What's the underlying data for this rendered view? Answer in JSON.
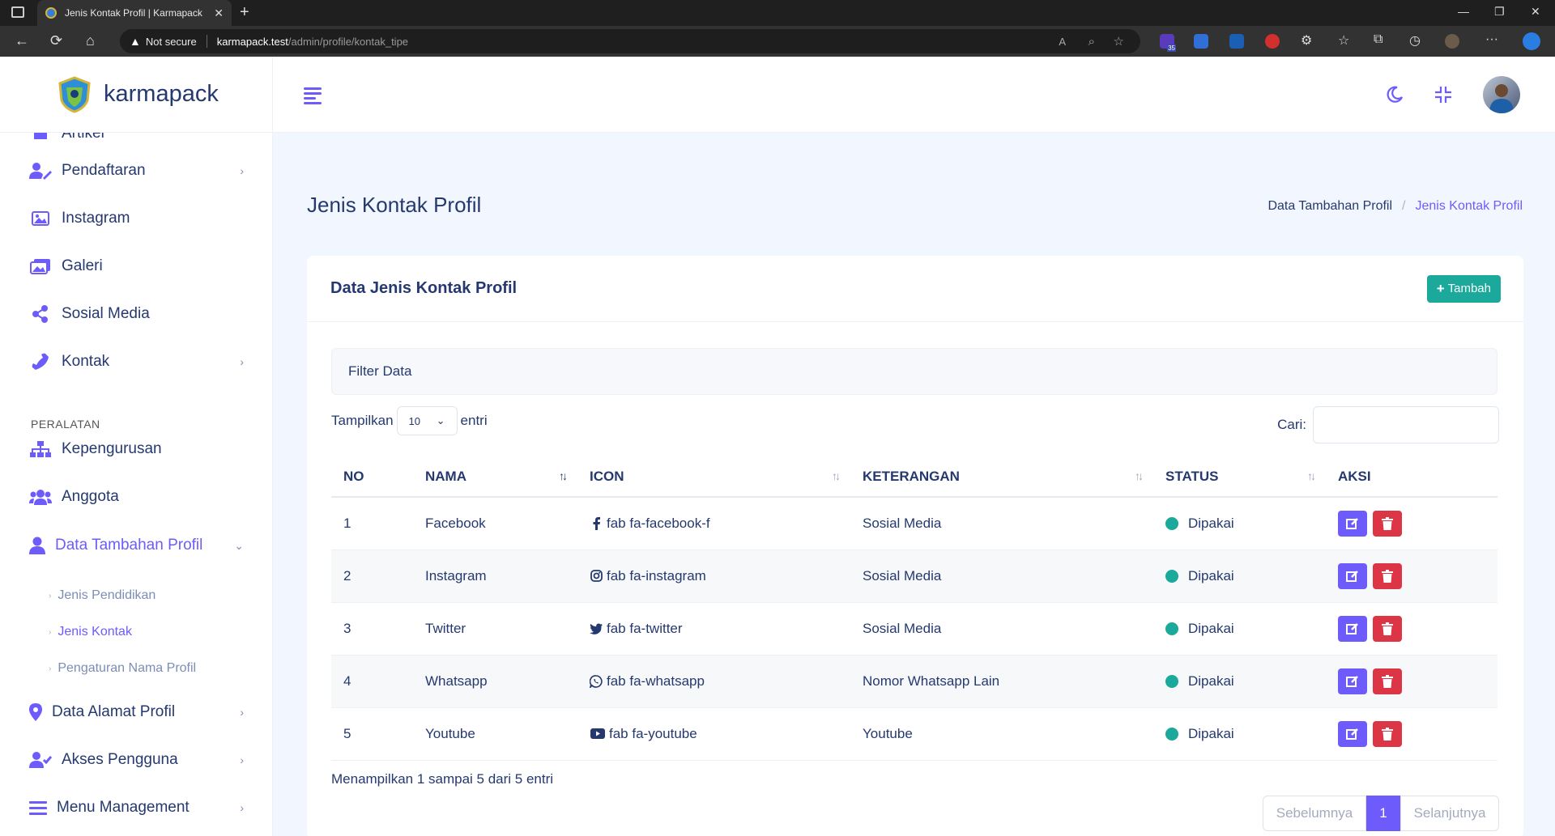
{
  "browser": {
    "tab_title": "Jenis Kontak Profil | Karmapack",
    "security_label": "Not secure",
    "url_host": "karmapack.test",
    "url_path": "/admin/profile/kontak_tipe",
    "tab_close": "✕",
    "new_tab": "+",
    "ext_badge": "35"
  },
  "sidebar": {
    "brand": "karmapack",
    "partial_item": "Artikel",
    "items": [
      {
        "label": "Pendaftaran",
        "icon": "user-edit-icon",
        "has_caret": true
      },
      {
        "label": "Instagram",
        "icon": "image-icon",
        "has_caret": false
      },
      {
        "label": "Galeri",
        "icon": "images-icon",
        "has_caret": false
      },
      {
        "label": "Sosial Media",
        "icon": "share-icon",
        "has_caret": false
      },
      {
        "label": "Kontak",
        "icon": "phone-icon",
        "has_caret": true
      }
    ],
    "section_title": "PERALATAN",
    "tools": [
      {
        "label": "Kepengurusan",
        "icon": "sitemap-icon"
      },
      {
        "label": "Anggota",
        "icon": "users-icon"
      },
      {
        "label": "Data Tambahan Profil",
        "icon": "user-icon"
      }
    ],
    "sub_items": [
      "Jenis Pendidikan",
      "Jenis Kontak",
      "Pengaturan Nama Profil"
    ],
    "bottom_items": [
      {
        "label": "Data Alamat Profil",
        "icon": "map-marker-icon"
      },
      {
        "label": "Akses Pengguna",
        "icon": "user-check-icon"
      },
      {
        "label": "Menu Management",
        "icon": "bars-icon"
      }
    ]
  },
  "page": {
    "title": "Jenis Kontak Profil",
    "breadcrumb": {
      "parent": "Data Tambahan Profil",
      "separator": "/",
      "current": "Jenis Kontak Profil"
    }
  },
  "card": {
    "title": "Data Jenis Kontak Profil",
    "add_label": "Tambah",
    "add_plus": "+",
    "filter_label": "Filter Data",
    "show_label": "Tampilkan",
    "page_size": "10",
    "entries_label": "entri",
    "search_label": "Cari:"
  },
  "table": {
    "headers": [
      "NO",
      "NAMA",
      "ICON",
      "KETERANGAN",
      "STATUS",
      "AKSI"
    ],
    "sort_glyph": "↑↓",
    "rows": [
      {
        "no": "1",
        "nama": "Facebook",
        "icon": "fab fa-facebook-f",
        "icon_name": "facebook-icon",
        "keterangan": "Sosial Media",
        "status": "Dipakai"
      },
      {
        "no": "2",
        "nama": "Instagram",
        "icon": "fab fa-instagram",
        "icon_name": "instagram-icon",
        "keterangan": "Sosial Media",
        "status": "Dipakai"
      },
      {
        "no": "3",
        "nama": "Twitter",
        "icon": "fab fa-twitter",
        "icon_name": "twitter-icon",
        "keterangan": "Sosial Media",
        "status": "Dipakai"
      },
      {
        "no": "4",
        "nama": "Whatsapp",
        "icon": "fab fa-whatsapp",
        "icon_name": "whatsapp-icon",
        "keterangan": "Nomor Whatsapp Lain",
        "status": "Dipakai"
      },
      {
        "no": "5",
        "nama": "Youtube",
        "icon": "fab fa-youtube",
        "icon_name": "youtube-icon",
        "keterangan": "Youtube",
        "status": "Dipakai"
      }
    ]
  },
  "footer": {
    "info": "Menampilkan 1 sampai 5 dari 5 entri",
    "prev": "Sebelumnya",
    "current_page": "1",
    "next": "Selanjutnya"
  },
  "colors": {
    "primary": "#6d5cfb",
    "success": "#1aa99a",
    "danger": "#dc3545",
    "text": "#25396f",
    "background": "#f2f7ff"
  }
}
